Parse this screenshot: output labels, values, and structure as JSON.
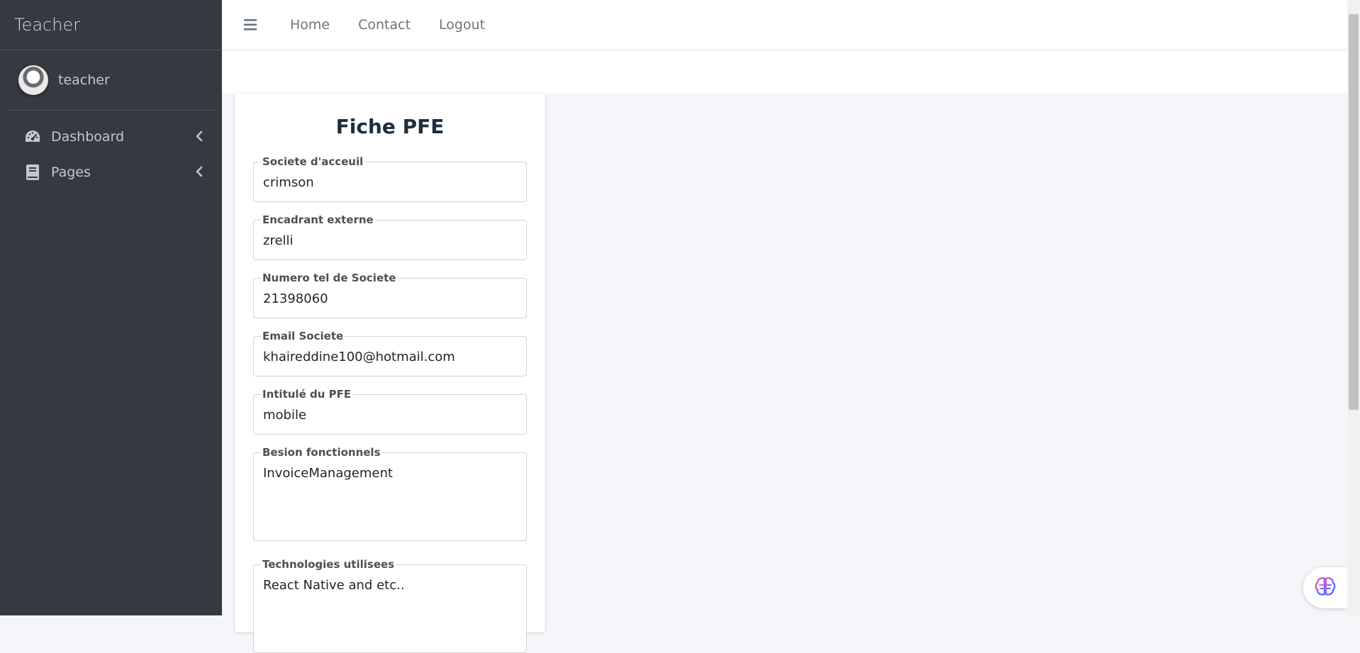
{
  "sidebar": {
    "brand": "Teacher",
    "user": {
      "name": "teacher",
      "avatar_icon": "user-avatar"
    },
    "items": [
      {
        "label": "Dashboard",
        "icon": "tachometer-icon"
      },
      {
        "label": "Pages",
        "icon": "book-icon"
      }
    ]
  },
  "navbar": {
    "menu_icon": "hamburger-icon",
    "links": [
      "Home",
      "Contact",
      "Logout"
    ]
  },
  "form": {
    "title": "Fiche PFE",
    "fields": [
      {
        "label": "Societe d'acceuil",
        "value": "crimson"
      },
      {
        "label": "Encadrant externe",
        "value": "zrelli"
      },
      {
        "label": "Numero tel de Societe",
        "value": "21398060"
      },
      {
        "label": "Email Societe",
        "value": "khaireddine100@hotmail.com"
      },
      {
        "label": "Intitulé du PFE",
        "value": "mobile"
      },
      {
        "label": "Besion fonctionnels",
        "value": "InvoiceManagement"
      },
      {
        "label": "Technologies utilisees",
        "value": "React Native and etc.."
      }
    ]
  },
  "colors": {
    "sidebar_bg": "#343a40",
    "sidebar_text": "#c2c7d0",
    "page_bg": "#f4f6f9"
  }
}
